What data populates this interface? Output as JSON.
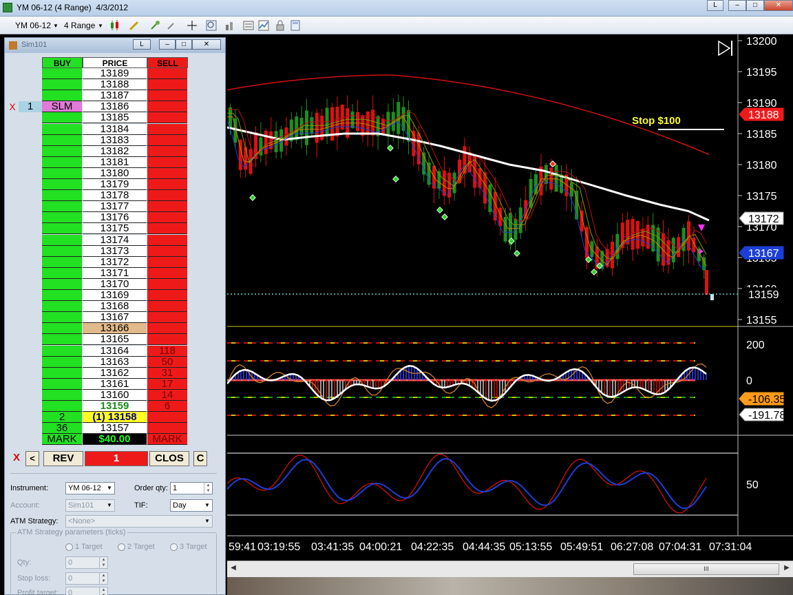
{
  "window": {
    "title": "YM 06-12 (4 Range)  4/3/2012",
    "btn_l": "L",
    "btn_min": "–",
    "btn_max": "□",
    "btn_close": "✕"
  },
  "toolbar": {
    "instrument": "YM 06-12",
    "period": "4 Range"
  },
  "dom": {
    "title": "Sim101",
    "btn_l": "L",
    "btn_min": "–",
    "btn_max": "□",
    "btn_close": "✕",
    "headers": {
      "buy": "BUY",
      "price": "PRICE",
      "sell": "SELL"
    },
    "rows": [
      {
        "price": "13189"
      },
      {
        "price": "13188"
      },
      {
        "price": "13187"
      },
      {
        "price": "13186",
        "x": "X",
        "qty": "1",
        "buy": "SLM"
      },
      {
        "price": "13185"
      },
      {
        "price": "13184"
      },
      {
        "price": "13183"
      },
      {
        "price": "13182"
      },
      {
        "price": "13181"
      },
      {
        "price": "13180"
      },
      {
        "price": "13179"
      },
      {
        "price": "13178"
      },
      {
        "price": "13177"
      },
      {
        "price": "13176"
      },
      {
        "price": "13175"
      },
      {
        "price": "13174"
      },
      {
        "price": "13173"
      },
      {
        "price": "13172"
      },
      {
        "price": "13171"
      },
      {
        "price": "13170"
      },
      {
        "price": "13169"
      },
      {
        "price": "13168"
      },
      {
        "price": "13167"
      },
      {
        "price": "13166"
      },
      {
        "price": "13165"
      },
      {
        "price": "13164",
        "sell": "118"
      },
      {
        "price": "13163",
        "sell": "50"
      },
      {
        "price": "13162",
        "sell": "31"
      },
      {
        "price": "13161",
        "sell": "17"
      },
      {
        "price": "13160",
        "sell": "14"
      },
      {
        "price": "13159",
        "sell": "6"
      },
      {
        "price": "(1) 13158",
        "buy": "2"
      },
      {
        "price": "13157",
        "buy": "36"
      },
      {
        "price": "$40.00",
        "buy": "MARK",
        "sell": "MARK"
      }
    ],
    "order_bar": {
      "x": "X",
      "prev": "<",
      "rev": "REV",
      "qty": "1",
      "close": "CLOS",
      "c": "C"
    },
    "params": {
      "instrument_label": "Instrument:",
      "instrument_value": "YM 06-12",
      "order_qty_label": "Order qty:",
      "order_qty_value": "1",
      "account_label": "Account:",
      "account_value": "Sim101",
      "tif_label": "TIF:",
      "tif_value": "Day",
      "atm_label": "ATM Strategy:",
      "atm_value": "<None>",
      "group_label": "ATM Strategy parameters (ticks)",
      "target1": "1 Target",
      "target2": "2 Target",
      "target3": "3 Target",
      "qty_label": "Qty:",
      "qty_value": "0",
      "stop_label": "Stop loss:",
      "stop_value": "0",
      "profit_label": "Profit target:",
      "profit_value": "0"
    }
  },
  "chart": {
    "stop_label": "Stop $100",
    "price_axis": [
      "13200",
      "13195",
      "13190",
      "13185",
      "13180",
      "13175",
      "13170",
      "13165",
      "13160",
      "13155"
    ],
    "price_tags": {
      "red": "13188",
      "white": "13172",
      "blue": "13167",
      "last": "13159"
    },
    "osc_axis": [
      "200",
      "0"
    ],
    "osc_tags": {
      "orange": "-106.35",
      "white": "-191.78"
    },
    "stoch_axis": [
      "50"
    ],
    "time_axis": [
      "59:41",
      "03:19:55",
      "03:41:35",
      "04:00:21",
      "04:22:35",
      "04:44:35",
      "05:13:55",
      "05:49:51",
      "06:27:08",
      "07:04:31",
      "07:31:04"
    ],
    "colors": {
      "up": "#1e8f1e",
      "down": "#e01010",
      "bg": "#000000"
    }
  },
  "scroll": {
    "thumb_grip": "III"
  }
}
